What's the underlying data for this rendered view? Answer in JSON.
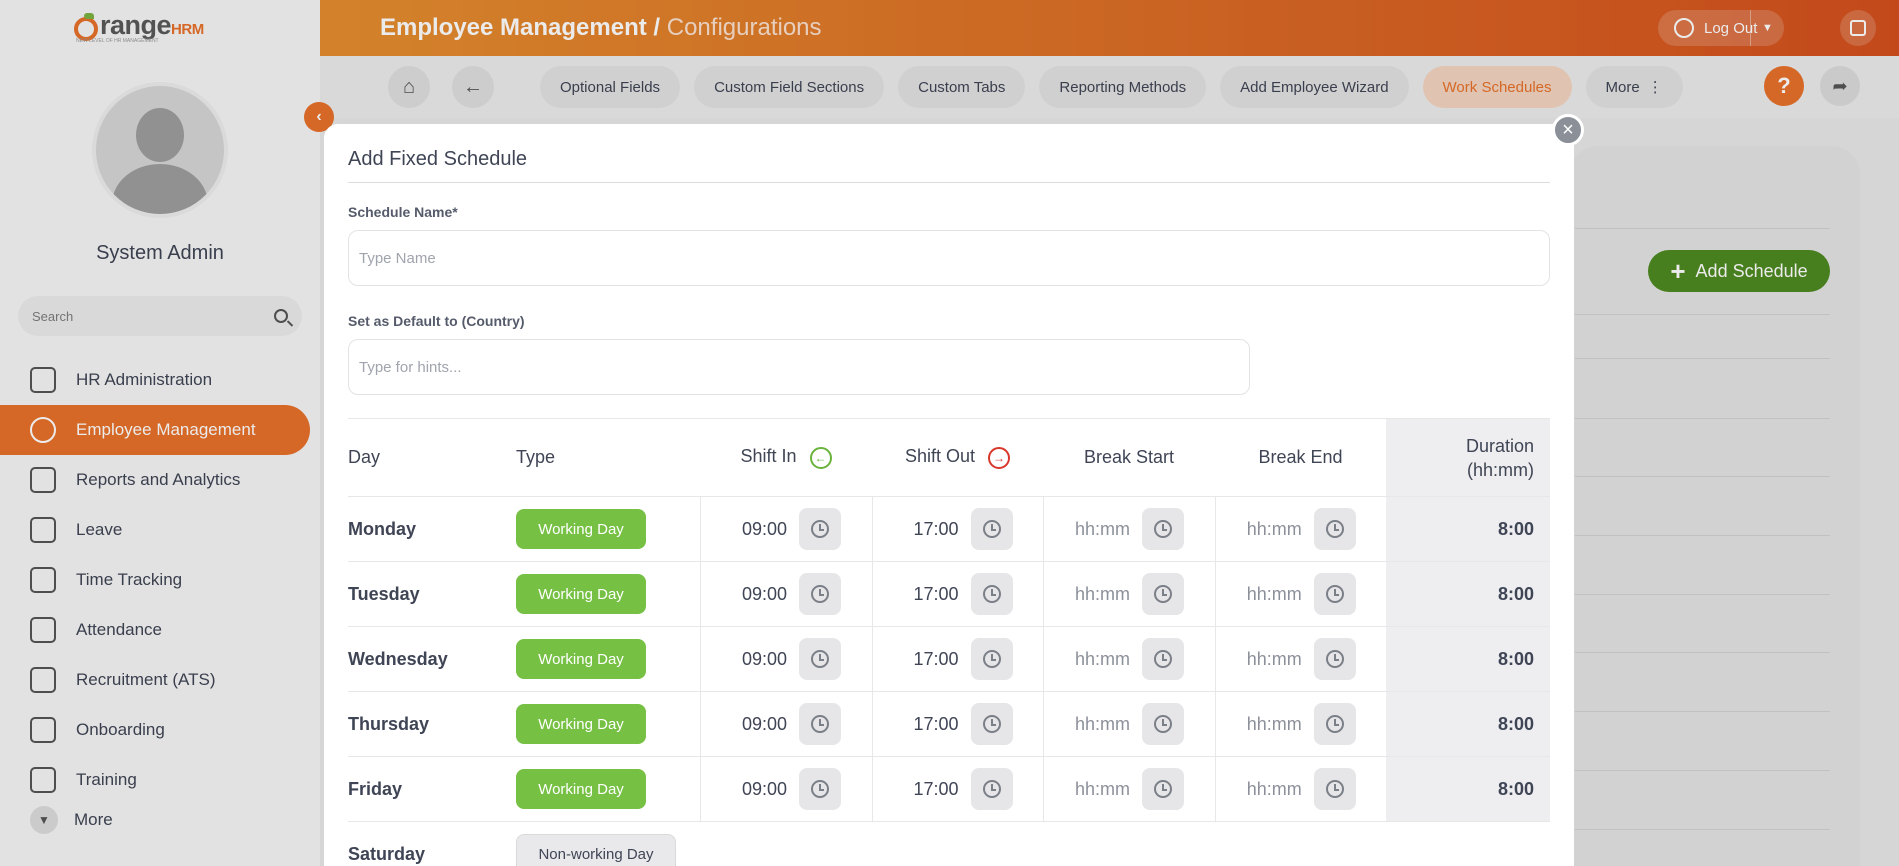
{
  "app": {
    "logo_text": "range",
    "logo_hrm": "HRM",
    "logo_tagline": "NEW LEVEL OF HR MANAGEMENT",
    "title_main": "Employee Management /",
    "title_sub": "Configurations"
  },
  "sidebar": {
    "user_name": "System Admin",
    "search_placeholder": "Search",
    "items": [
      {
        "label": "HR Administration",
        "active": false
      },
      {
        "label": "Employee Management",
        "active": true
      },
      {
        "label": "Reports and Analytics",
        "active": false
      },
      {
        "label": "Leave",
        "active": false
      },
      {
        "label": "Time Tracking",
        "active": false
      },
      {
        "label": "Attendance",
        "active": false
      },
      {
        "label": "Recruitment (ATS)",
        "active": false
      },
      {
        "label": "Onboarding",
        "active": false
      },
      {
        "label": "Training",
        "active": false
      }
    ],
    "more_label": "More"
  },
  "topbar": {
    "logout_label": "Log Out"
  },
  "subnav": {
    "tabs": [
      {
        "label": "Optional Fields"
      },
      {
        "label": "Custom Field Sections"
      },
      {
        "label": "Custom Tabs"
      },
      {
        "label": "Reporting Methods"
      },
      {
        "label": "Add Employee Wizard"
      },
      {
        "label": "Work Schedules"
      },
      {
        "label": "More"
      }
    ],
    "help_label": "?"
  },
  "page": {
    "add_schedule_label": "Add Schedule"
  },
  "modal": {
    "title": "Add Fixed Schedule",
    "schedule_name_label": "Schedule Name*",
    "schedule_name_placeholder": "Type Name",
    "default_country_label": "Set as Default to (Country)",
    "default_country_placeholder": "Type for hints...",
    "columns": {
      "day": "Day",
      "type": "Type",
      "shift_in": "Shift In",
      "shift_out": "Shift Out",
      "break_start": "Break Start",
      "break_end": "Break End",
      "duration_line1": "Duration",
      "duration_line2": "(hh:mm)"
    },
    "rows": [
      {
        "day": "Monday",
        "type": "Working Day",
        "shift_in": "09:00",
        "shift_out": "17:00",
        "break_start": "hh:mm",
        "break_end": "hh:mm",
        "duration": "8:00"
      },
      {
        "day": "Tuesday",
        "type": "Working Day",
        "shift_in": "09:00",
        "shift_out": "17:00",
        "break_start": "hh:mm",
        "break_end": "hh:mm",
        "duration": "8:00"
      },
      {
        "day": "Wednesday",
        "type": "Working Day",
        "shift_in": "09:00",
        "shift_out": "17:00",
        "break_start": "hh:mm",
        "break_end": "hh:mm",
        "duration": "8:00"
      },
      {
        "day": "Thursday",
        "type": "Working Day",
        "shift_in": "09:00",
        "shift_out": "17:00",
        "break_start": "hh:mm",
        "break_end": "hh:mm",
        "duration": "8:00"
      },
      {
        "day": "Friday",
        "type": "Working Day",
        "shift_in": "09:00",
        "shift_out": "17:00",
        "break_start": "hh:mm",
        "break_end": "hh:mm",
        "duration": "8:00"
      }
    ],
    "saturday": {
      "day": "Saturday",
      "type": "Non-working Day"
    }
  },
  "colors": {
    "brand_orange": "#e8712a",
    "working_green": "#76c043",
    "add_green": "#4f8a21"
  }
}
